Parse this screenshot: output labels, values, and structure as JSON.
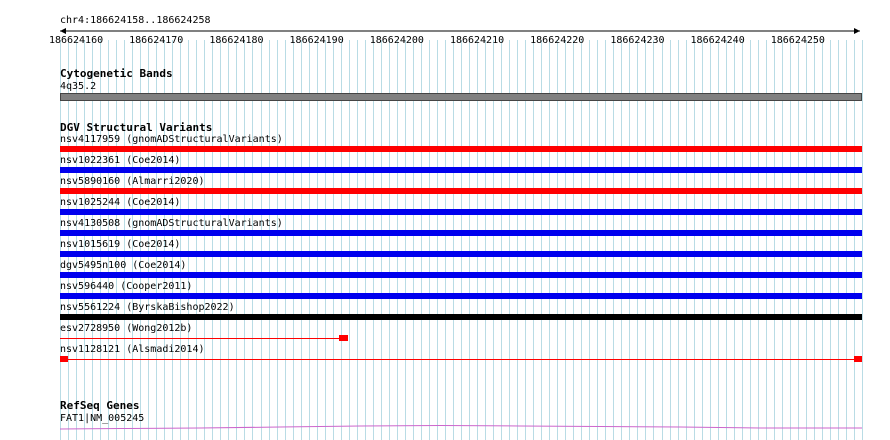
{
  "ruler": {
    "region": "chr4:186624158..186624258",
    "start": 186624158,
    "end": 186624258,
    "tick_labels": [
      "186624160",
      "186624170",
      "186624180",
      "186624190",
      "186624200",
      "186624210",
      "186624220",
      "186624230",
      "186624240",
      "186624250"
    ]
  },
  "tracks": {
    "cytoband": {
      "title": "Cytogenetic Bands",
      "band_label": "4q35.2",
      "band_color": "#808080"
    },
    "dgv": {
      "title": "DGV Structural Variants",
      "features": [
        {
          "label": "nsv4117959 (gnomADStructuralVariants)",
          "color": "#ff0000",
          "style": "full"
        },
        {
          "label": "nsv1022361 (Coe2014)",
          "color": "#0000ee",
          "style": "full"
        },
        {
          "label": "nsv5890160 (Almarri2020)",
          "color": "#ff0000",
          "style": "full"
        },
        {
          "label": "nsv1025244 (Coe2014)",
          "color": "#0000ee",
          "style": "full"
        },
        {
          "label": "nsv4130508 (gnomADStructuralVariants)",
          "color": "#0000ee",
          "style": "full"
        },
        {
          "label": "nsv1015619 (Coe2014)",
          "color": "#0000ee",
          "style": "full"
        },
        {
          "label": "dgv5495n100 (Coe2014)",
          "color": "#0000ee",
          "style": "full"
        },
        {
          "label": "nsv596440 (Cooper2011)",
          "color": "#0000ee",
          "style": "full"
        },
        {
          "label": "nsv5561224 (ByrskaBishop2022)",
          "color": "#000000",
          "style": "full"
        },
        {
          "label": "esv2728950 (Wong2012b)",
          "color": "#ff0000",
          "style": "left-line",
          "block_end": 186624193
        },
        {
          "label": "nsv1128121 (Alsmadi2014)",
          "color": "#ff0000",
          "style": "spanning-line"
        }
      ]
    },
    "refseq": {
      "title": "RefSeq Genes",
      "transcript": "FAT1|NM_005245",
      "color": "#cc66cc"
    }
  }
}
